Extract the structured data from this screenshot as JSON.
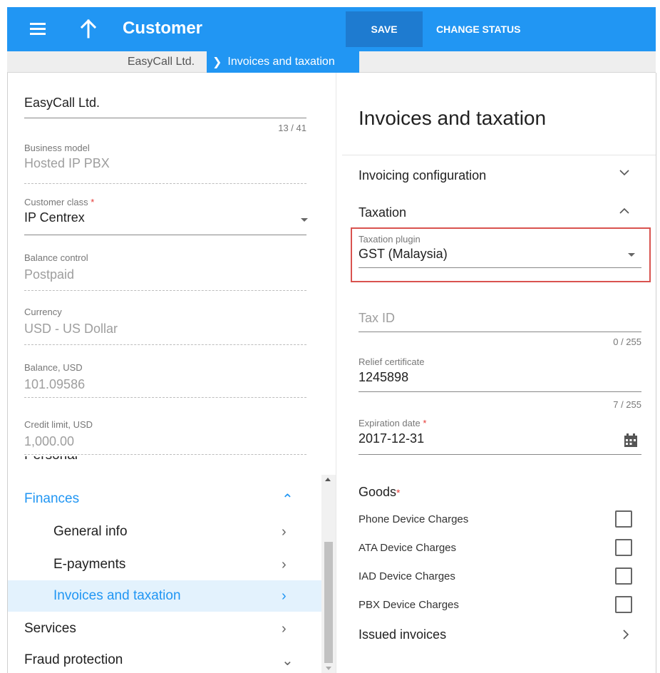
{
  "header": {
    "title": "Customer",
    "save_label": "SAVE",
    "change_status_label": "CHANGE STATUS"
  },
  "breadcrumb": {
    "root": "EasyCall Ltd.",
    "current": "Invoices and taxation"
  },
  "left": {
    "name_value": "EasyCall Ltd.",
    "name_counter": "13 / 41",
    "fields": [
      {
        "label": "Business model",
        "value": "Hosted IP PBX"
      },
      {
        "label": "Customer class",
        "value": "IP Centrex",
        "required": "*"
      },
      {
        "label": "Balance control",
        "value": "Postpaid"
      },
      {
        "label": "Currency",
        "value": "USD - US Dollar"
      },
      {
        "label": "Balance, USD",
        "value": "101.09586"
      },
      {
        "label": "Credit limit, USD",
        "value": "1,000.00"
      }
    ]
  },
  "nav": {
    "cut_item": "Personal",
    "items": [
      {
        "label": "Finances",
        "icon": "chevron-up"
      },
      {
        "label": "General info",
        "icon": "chevron-right"
      },
      {
        "label": "E-payments",
        "icon": "chevron-right"
      },
      {
        "label": "Invoices and taxation",
        "icon": "chevron-right"
      },
      {
        "label": "Services",
        "icon": "chevron-right"
      },
      {
        "label": "Fraud protection",
        "icon": "chevron-down"
      }
    ]
  },
  "right": {
    "title": "Invoices and taxation",
    "invoicing_config": "Invoicing configuration",
    "taxation": "Taxation",
    "taxation_plugin_label": "Taxation plugin",
    "taxation_plugin_value": "GST (Malaysia)",
    "tax_id_placeholder": "Tax ID",
    "tax_id_counter": "0 / 255",
    "relief_label": "Relief certificate",
    "relief_value": "1245898",
    "relief_counter": "7 / 255",
    "expiration_label": "Expiration date",
    "expiration_required": "*",
    "expiration_value": "2017-12-31",
    "goods_label": "Goods",
    "goods_required": "*",
    "goods": [
      {
        "label": "Phone Device Charges",
        "checked": false
      },
      {
        "label": "ATA Device Charges",
        "checked": false
      },
      {
        "label": "IAD Device Charges",
        "checked": false
      },
      {
        "label": "PBX Device Charges",
        "checked": false
      }
    ],
    "issued_invoices": "Issued invoices"
  },
  "colors": {
    "accent": "#2196f3",
    "highlight_border": "#d9534f",
    "active_bg": "#e3f2fd"
  }
}
